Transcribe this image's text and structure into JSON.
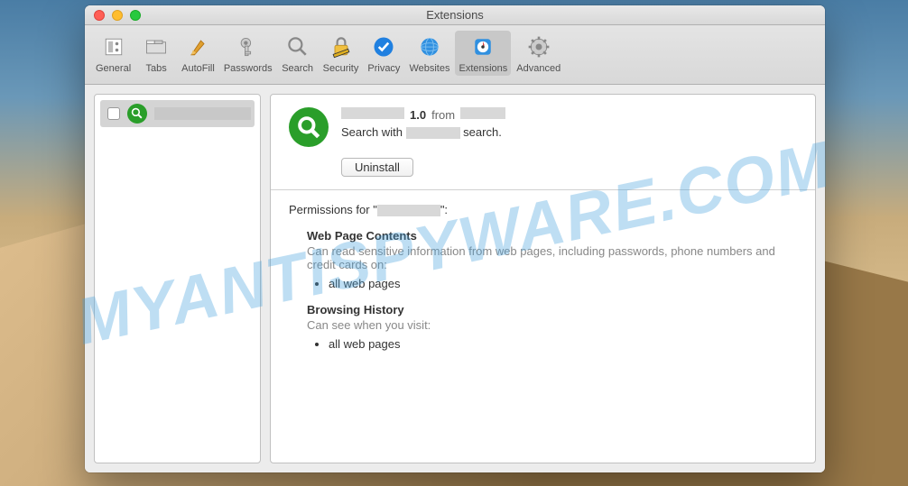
{
  "window": {
    "title": "Extensions"
  },
  "toolbar": {
    "items": [
      {
        "label": "General",
        "icon": "general"
      },
      {
        "label": "Tabs",
        "icon": "tabs"
      },
      {
        "label": "AutoFill",
        "icon": "autofill"
      },
      {
        "label": "Passwords",
        "icon": "passwords"
      },
      {
        "label": "Search",
        "icon": "search"
      },
      {
        "label": "Security",
        "icon": "security"
      },
      {
        "label": "Privacy",
        "icon": "privacy"
      },
      {
        "label": "Websites",
        "icon": "websites"
      },
      {
        "label": "Extensions",
        "icon": "extensions",
        "active": true
      },
      {
        "label": "Advanced",
        "icon": "advanced"
      }
    ]
  },
  "sidebar": {
    "extension": {
      "checked": false,
      "name_hidden": true
    }
  },
  "detail": {
    "version": "1.0",
    "from_label": "from",
    "desc_prefix": "Search with",
    "desc_suffix": "search.",
    "uninstall_label": "Uninstall"
  },
  "permissions": {
    "title_prefix": "Permissions for \"",
    "title_suffix": "\":",
    "groups": [
      {
        "heading": "Web Page Contents",
        "desc": "Can read sensitive information from web pages, including passwords, phone numbers and credit cards on:",
        "items": [
          "all web pages"
        ]
      },
      {
        "heading": "Browsing History",
        "desc": "Can see when you visit:",
        "items": [
          "all web pages"
        ]
      }
    ]
  },
  "watermark": "MYANTISPYWARE.COM"
}
